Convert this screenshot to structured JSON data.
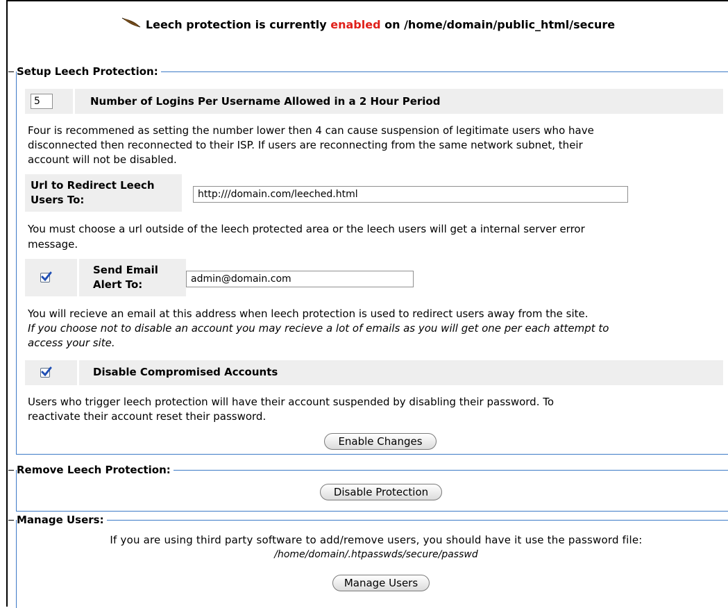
{
  "banner": {
    "prefix": "Leech protection is currently",
    "status": "enabled",
    "suffix": "on /home/domain/public_html/secure"
  },
  "setup": {
    "legend": "Setup Leech Protection:",
    "logins_value": "5",
    "logins_label": "Number of Logins Per Username Allowed in a 2 Hour Period",
    "logins_help_1": "Four is recommened as setting the number lower then 4 can cause suspension of legitimate users who have",
    "logins_help_2": "disconnected then reconnected to their ISP. If users are reconnecting from the same network subnet, their",
    "logins_help_3": "account will not be disabled.",
    "url_label_1": "Url to Redirect Leech",
    "url_label_2": "Users To:",
    "url_value": "http:///domain.com/leeched.html",
    "url_help_1": "You must choose a url outside of the leech protected area or the leech users will get a internal server error",
    "url_help_2": "message.",
    "email_checked": true,
    "email_label_1": "Send Email",
    "email_label_2": "Alert To:",
    "email_value": "admin@domain.com",
    "email_help_1": "You will recieve an email at this address when leech protection is used to redirect users away from the site.",
    "email_help_2": "If you choose not to disable an account you may recieve a lot of emails as you will get one per each attempt to",
    "email_help_3": "access your site.",
    "disable_checked": true,
    "disable_label": "Disable Compromised Accounts",
    "disable_help_1": "Users who trigger leech protection will have their account suspended by disabling their password. To",
    "disable_help_2": "reactivate their account reset their password.",
    "enable_button": "Enable Changes"
  },
  "remove": {
    "legend": "Remove Leech Protection:",
    "disable_button": "Disable Protection"
  },
  "manage": {
    "legend": "Manage Users:",
    "help": "If you are using third party software to add/remove users, you should have it use the password file:",
    "path": "/home/domain/.htpasswds/secure/passwd",
    "manage_button": "Manage Users"
  },
  "colors": {
    "status_enabled": "#e0201a",
    "fieldset_border": "#3b79c6",
    "row_grey": "#eeeeee",
    "checkbox_mark": "#1f4fb5"
  },
  "icons": {
    "banner": "feather-icon",
    "checkbox": "checkmark-icon"
  }
}
